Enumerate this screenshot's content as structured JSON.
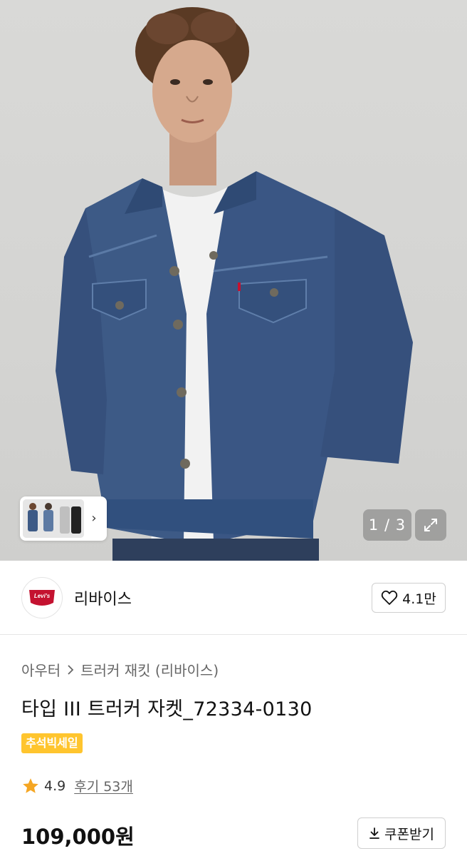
{
  "gallery": {
    "counter": "1 / 3",
    "next_arrow": "›",
    "icons": {
      "expand": "expand-icon",
      "next": "chevron-right-icon"
    }
  },
  "brand": {
    "logo_text": "Levi's",
    "name": "리바이스",
    "like_count": "4.1만",
    "icons": {
      "like": "heart-outline-icon"
    }
  },
  "product": {
    "breadcrumb": [
      "아우터",
      "트러커 재킷 (리바이스)"
    ],
    "title": "타입 III 트러커 자켓_72334-0130",
    "badge": "추석빅세일",
    "rating": "4.9",
    "reviews": "후기 53개",
    "price": "109,000원",
    "coupon_label": "쿠폰받기",
    "icons": {
      "star": "star-filled-icon",
      "coupon": "download-icon",
      "breadcrumb_sep": "chevron-right-icon"
    }
  },
  "colors": {
    "badge_bg": "#ffc52e",
    "star": "#f5a623",
    "denim": "#3d5a86",
    "levis_red": "#c41230"
  }
}
